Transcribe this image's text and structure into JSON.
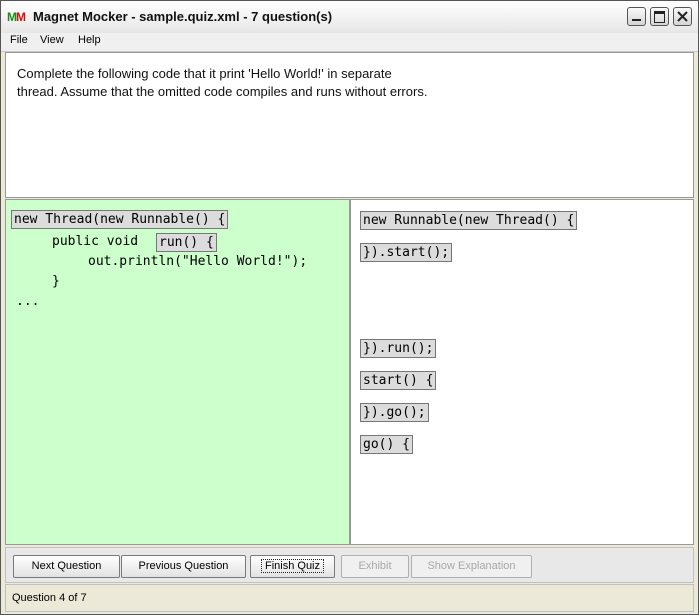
{
  "window": {
    "title": "Magnet Mocker - sample.quiz.xml - 7 question(s)",
    "icon_letters": [
      "M",
      "M"
    ]
  },
  "menu": {
    "file": "File",
    "view": "View",
    "help": "Help"
  },
  "question": {
    "line1": "Complete the following code that it print 'Hello World!' in separate",
    "line2": "thread. Assume that the omitted code compiles and runs without errors."
  },
  "answer_area": {
    "placed_magnet_1": "new Thread(new Runnable() {",
    "static_line_public": "public void",
    "placed_magnet_2": "run() {",
    "static_line_println": "out.println(\"Hello World!\");",
    "static_line_close": "}",
    "static_line_ellipsis": "..."
  },
  "magnets": {
    "m1": "new Runnable(new Thread() {",
    "m2": "}).start();",
    "m3": "}).run();",
    "m4": "start() {",
    "m5": "}).go();",
    "m6": "go() {"
  },
  "buttons": {
    "next": "Next Question",
    "previous": "Previous Question",
    "finish": "Finish Quiz",
    "exhibit": "Exhibit",
    "explanation": "Show Explanation"
  },
  "status": {
    "text": "Question 4 of 7"
  },
  "colors": {
    "answer_bg": "#ccffcc",
    "magnet_bg": "#dcdcdc"
  }
}
